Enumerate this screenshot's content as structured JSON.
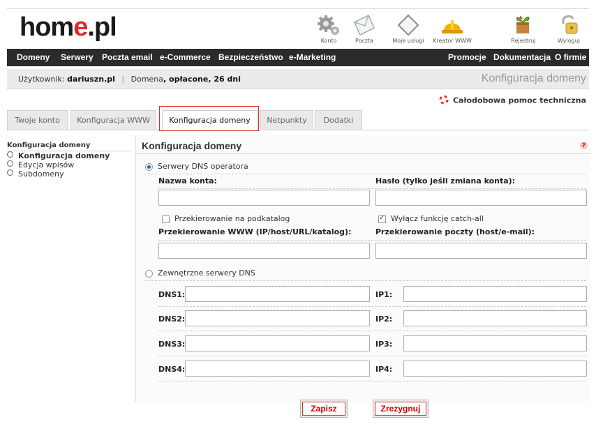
{
  "logo": {
    "part1": "hom",
    "part2": "e",
    "part3": ".pl"
  },
  "top_icons": [
    {
      "icon": "gear-icon",
      "label": "Konto"
    },
    {
      "icon": "mail-icon",
      "label": "Poczta"
    },
    {
      "icon": "services-icon",
      "label": "Moje usługi"
    },
    {
      "icon": "hardhat-icon",
      "label": "Kreator WWW"
    },
    {
      "icon": "register-icon",
      "label": "Rejestruj"
    },
    {
      "icon": "logout-icon",
      "label": "Wyloguj"
    }
  ],
  "nav": {
    "left": [
      "Domeny",
      "Serwery",
      "Poczta email",
      "e-Commerce",
      "Bezpieczeństwo",
      "e-Marketing"
    ],
    "right": [
      "Promocje",
      "Dokumentacja",
      "O firmie"
    ]
  },
  "userbar": {
    "user_label": "Użytkownik:",
    "user_name": "dariuszn.pl",
    "separator": "|",
    "domain_label": "Domena",
    "domain_status": ", opłacone, 26 dni",
    "page_title": "Konfiguracja domeny"
  },
  "help_text": "Całodobowa pomoc techniczna",
  "tabs": [
    "Twoje konto",
    "Konfiguracja WWW",
    "Konfiguracja domeny",
    "Netpunkty",
    "Dodatki"
  ],
  "active_tab": "Konfiguracja domeny",
  "sidebar": {
    "title": "Konfiguracja domeny",
    "items": [
      "Konfiguracja domeny",
      "Edycja wpisów",
      "Subdomeny"
    ]
  },
  "panel": {
    "title": "Konfiguracja domeny",
    "help_icon": "?",
    "option_operator": "Serwery DNS operatora",
    "option_operator_selected": true,
    "account_name_label": "Nazwa konta:",
    "password_label": "Hasło (tylko jeśli zmiana konta):",
    "account_name_value": "",
    "password_value": "",
    "redirect_subdir_label": "Przekierowanie na podkatalog",
    "redirect_subdir_checked": false,
    "catchall_label": "Wyłącz funkcję catch-all",
    "catchall_checked": true,
    "www_redirect_label": "Przekierowanie WWW (IP/host/URL/katalog):",
    "mail_redirect_label": "Przekierowanie poczty (host/e-mail):",
    "www_redirect_value": "",
    "mail_redirect_value": "",
    "option_external": "Zewnętrzne serwery DNS",
    "option_external_selected": false,
    "dns_rows": [
      {
        "dns_label": "DNS1:",
        "ip_label": "IP1:"
      },
      {
        "dns_label": "DNS2:",
        "ip_label": "IP2:"
      },
      {
        "dns_label": "DNS3:",
        "ip_label": "IP3:"
      },
      {
        "dns_label": "DNS4:",
        "ip_label": "IP4:"
      }
    ]
  },
  "buttons": {
    "save": "Zapisz",
    "cancel": "Zrezygnuj"
  },
  "colors": {
    "brand_red": "#e3262f",
    "navbar": "#2b2b2b",
    "button_text": "#cc0000",
    "tab_highlight": "#e02b2b"
  }
}
